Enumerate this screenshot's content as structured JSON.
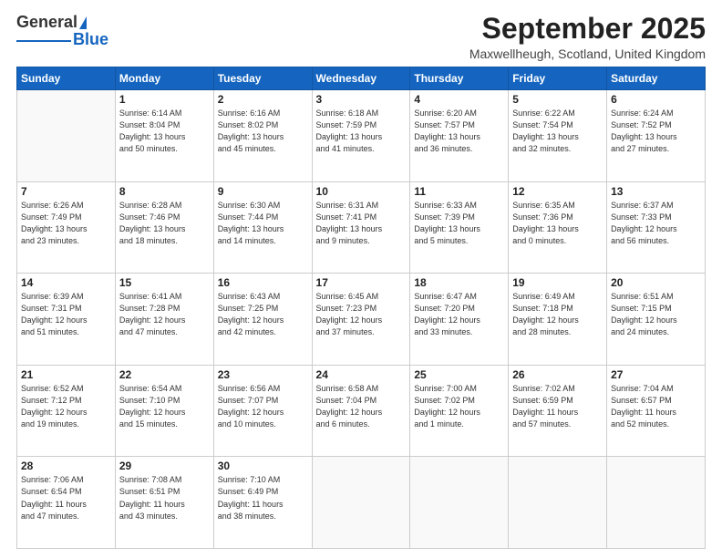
{
  "header": {
    "logo_general": "General",
    "logo_blue": "Blue",
    "title": "September 2025",
    "location": "Maxwellheugh, Scotland, United Kingdom"
  },
  "days_of_week": [
    "Sunday",
    "Monday",
    "Tuesday",
    "Wednesday",
    "Thursday",
    "Friday",
    "Saturday"
  ],
  "weeks": [
    [
      {
        "day": "",
        "info": ""
      },
      {
        "day": "1",
        "info": "Sunrise: 6:14 AM\nSunset: 8:04 PM\nDaylight: 13 hours\nand 50 minutes."
      },
      {
        "day": "2",
        "info": "Sunrise: 6:16 AM\nSunset: 8:02 PM\nDaylight: 13 hours\nand 45 minutes."
      },
      {
        "day": "3",
        "info": "Sunrise: 6:18 AM\nSunset: 7:59 PM\nDaylight: 13 hours\nand 41 minutes."
      },
      {
        "day": "4",
        "info": "Sunrise: 6:20 AM\nSunset: 7:57 PM\nDaylight: 13 hours\nand 36 minutes."
      },
      {
        "day": "5",
        "info": "Sunrise: 6:22 AM\nSunset: 7:54 PM\nDaylight: 13 hours\nand 32 minutes."
      },
      {
        "day": "6",
        "info": "Sunrise: 6:24 AM\nSunset: 7:52 PM\nDaylight: 13 hours\nand 27 minutes."
      }
    ],
    [
      {
        "day": "7",
        "info": "Sunrise: 6:26 AM\nSunset: 7:49 PM\nDaylight: 13 hours\nand 23 minutes."
      },
      {
        "day": "8",
        "info": "Sunrise: 6:28 AM\nSunset: 7:46 PM\nDaylight: 13 hours\nand 18 minutes."
      },
      {
        "day": "9",
        "info": "Sunrise: 6:30 AM\nSunset: 7:44 PM\nDaylight: 13 hours\nand 14 minutes."
      },
      {
        "day": "10",
        "info": "Sunrise: 6:31 AM\nSunset: 7:41 PM\nDaylight: 13 hours\nand 9 minutes."
      },
      {
        "day": "11",
        "info": "Sunrise: 6:33 AM\nSunset: 7:39 PM\nDaylight: 13 hours\nand 5 minutes."
      },
      {
        "day": "12",
        "info": "Sunrise: 6:35 AM\nSunset: 7:36 PM\nDaylight: 13 hours\nand 0 minutes."
      },
      {
        "day": "13",
        "info": "Sunrise: 6:37 AM\nSunset: 7:33 PM\nDaylight: 12 hours\nand 56 minutes."
      }
    ],
    [
      {
        "day": "14",
        "info": "Sunrise: 6:39 AM\nSunset: 7:31 PM\nDaylight: 12 hours\nand 51 minutes."
      },
      {
        "day": "15",
        "info": "Sunrise: 6:41 AM\nSunset: 7:28 PM\nDaylight: 12 hours\nand 47 minutes."
      },
      {
        "day": "16",
        "info": "Sunrise: 6:43 AM\nSunset: 7:25 PM\nDaylight: 12 hours\nand 42 minutes."
      },
      {
        "day": "17",
        "info": "Sunrise: 6:45 AM\nSunset: 7:23 PM\nDaylight: 12 hours\nand 37 minutes."
      },
      {
        "day": "18",
        "info": "Sunrise: 6:47 AM\nSunset: 7:20 PM\nDaylight: 12 hours\nand 33 minutes."
      },
      {
        "day": "19",
        "info": "Sunrise: 6:49 AM\nSunset: 7:18 PM\nDaylight: 12 hours\nand 28 minutes."
      },
      {
        "day": "20",
        "info": "Sunrise: 6:51 AM\nSunset: 7:15 PM\nDaylight: 12 hours\nand 24 minutes."
      }
    ],
    [
      {
        "day": "21",
        "info": "Sunrise: 6:52 AM\nSunset: 7:12 PM\nDaylight: 12 hours\nand 19 minutes."
      },
      {
        "day": "22",
        "info": "Sunrise: 6:54 AM\nSunset: 7:10 PM\nDaylight: 12 hours\nand 15 minutes."
      },
      {
        "day": "23",
        "info": "Sunrise: 6:56 AM\nSunset: 7:07 PM\nDaylight: 12 hours\nand 10 minutes."
      },
      {
        "day": "24",
        "info": "Sunrise: 6:58 AM\nSunset: 7:04 PM\nDaylight: 12 hours\nand 6 minutes."
      },
      {
        "day": "25",
        "info": "Sunrise: 7:00 AM\nSunset: 7:02 PM\nDaylight: 12 hours\nand 1 minute."
      },
      {
        "day": "26",
        "info": "Sunrise: 7:02 AM\nSunset: 6:59 PM\nDaylight: 11 hours\nand 57 minutes."
      },
      {
        "day": "27",
        "info": "Sunrise: 7:04 AM\nSunset: 6:57 PM\nDaylight: 11 hours\nand 52 minutes."
      }
    ],
    [
      {
        "day": "28",
        "info": "Sunrise: 7:06 AM\nSunset: 6:54 PM\nDaylight: 11 hours\nand 47 minutes."
      },
      {
        "day": "29",
        "info": "Sunrise: 7:08 AM\nSunset: 6:51 PM\nDaylight: 11 hours\nand 43 minutes."
      },
      {
        "day": "30",
        "info": "Sunrise: 7:10 AM\nSunset: 6:49 PM\nDaylight: 11 hours\nand 38 minutes."
      },
      {
        "day": "",
        "info": ""
      },
      {
        "day": "",
        "info": ""
      },
      {
        "day": "",
        "info": ""
      },
      {
        "day": "",
        "info": ""
      }
    ]
  ]
}
